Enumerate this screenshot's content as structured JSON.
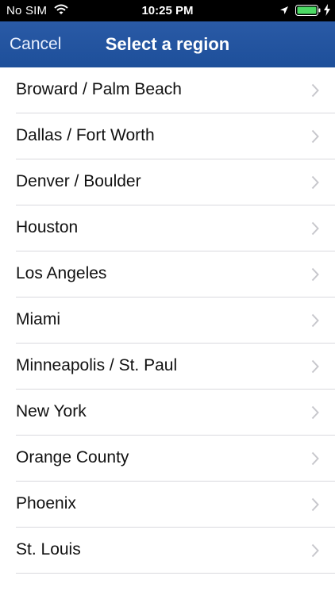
{
  "statusbar": {
    "carrier": "No SIM",
    "time": "10:25 PM",
    "icons": [
      "wifi-icon",
      "location-arrow-icon",
      "battery-icon",
      "charging-bolt-icon"
    ],
    "battery_color": "#4cd964"
  },
  "nav": {
    "cancel_label": "Cancel",
    "title": "Select a region",
    "color": "#2356a0"
  },
  "regions": [
    {
      "label": "Broward / Palm Beach"
    },
    {
      "label": "Dallas / Fort Worth"
    },
    {
      "label": "Denver / Boulder"
    },
    {
      "label": "Houston"
    },
    {
      "label": "Los Angeles"
    },
    {
      "label": "Miami"
    },
    {
      "label": "Minneapolis / St. Paul"
    },
    {
      "label": "New York"
    },
    {
      "label": "Orange County"
    },
    {
      "label": "Phoenix"
    },
    {
      "label": "St. Louis"
    }
  ]
}
